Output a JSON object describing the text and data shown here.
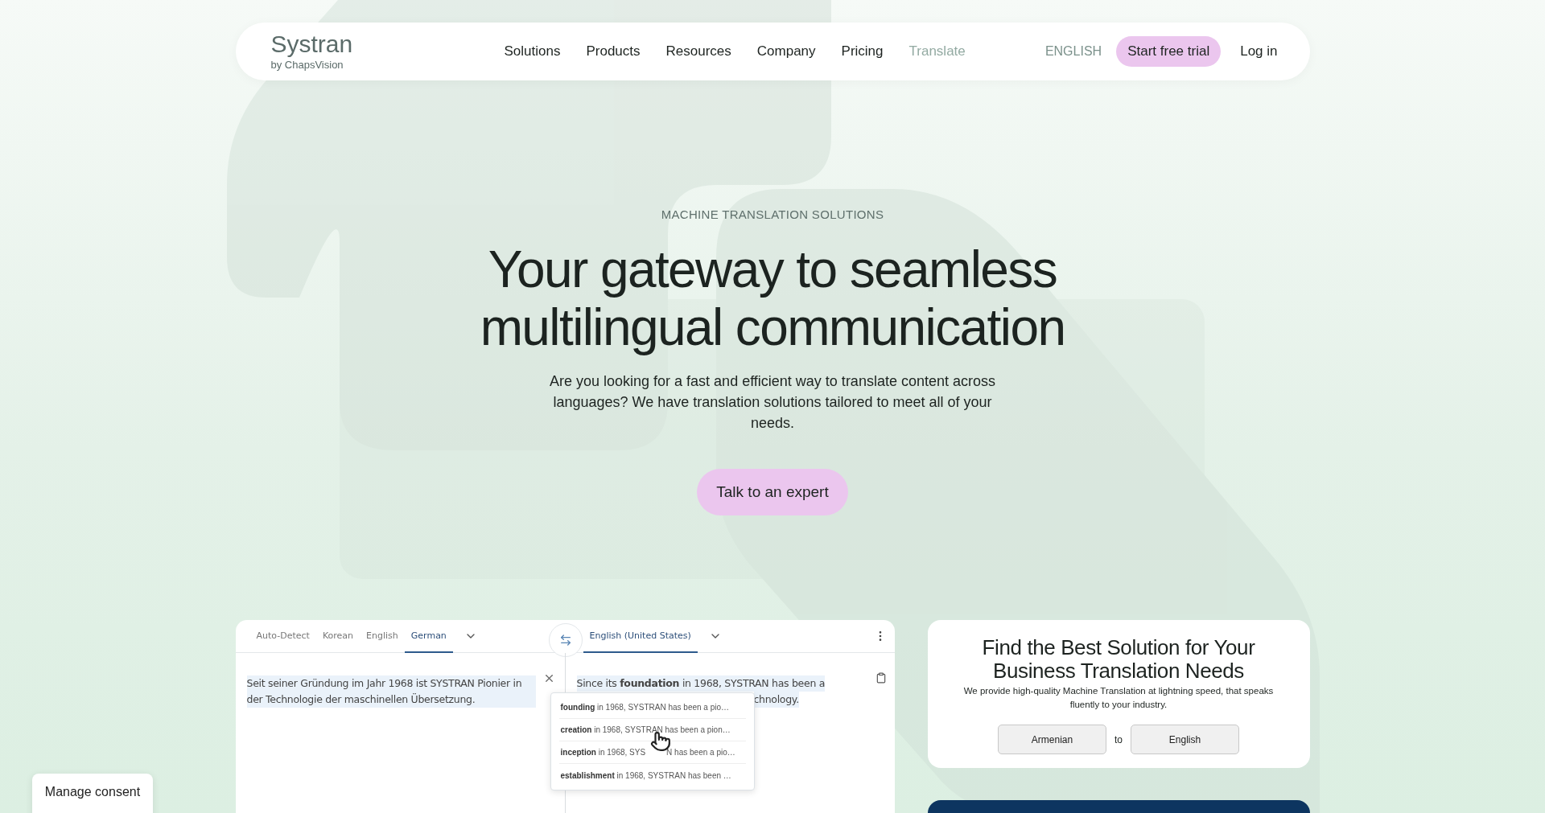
{
  "nav": {
    "logo": "Systran",
    "logo_sub": "by ChapsVision",
    "links": [
      {
        "label": "Solutions",
        "selected": false
      },
      {
        "label": "Products",
        "selected": false
      },
      {
        "label": "Resources",
        "selected": false
      },
      {
        "label": "Company",
        "selected": false
      },
      {
        "label": "Pricing",
        "selected": false
      },
      {
        "label": "Translate",
        "selected": true
      }
    ],
    "language": {
      "label": "ENGLISH",
      "selected": true
    },
    "cta": "Start free trial",
    "login": "Log in"
  },
  "hero": {
    "eyebrow": "MACHINE TRANSLATION SOLUTIONS",
    "title_lines": [
      "Your gateway to seamless",
      "multilingual communication"
    ],
    "paragraph": "Are you looking for a fast and efficient way to translate content across languages? We have translation solutions tailored to meet all of your needs.",
    "button": "Talk to an expert"
  },
  "translator": {
    "source_tabs": [
      {
        "label": "Auto-Detect",
        "selected": false
      },
      {
        "label": "Korean",
        "selected": false
      },
      {
        "label": "English",
        "selected": false
      },
      {
        "label": "German",
        "selected": true
      }
    ],
    "target_tabs": [
      {
        "label": "English (United States)",
        "selected": true
      }
    ],
    "source_text": "Seit seiner Gründung im Jahr 1968 ist SYSTRAN Pionier in der Technologie der maschinellen Übersetzung.",
    "target_text": "Since its **foundation** in 1968, SYSTRAN has been a",
    "target_text_tail": "chnology.",
    "suggestions": [
      {
        "text": "**founding** in 1968, SYSTRAN has been a pio…"
      },
      {
        "text": "**creation** in 1968, SYSTRAN has been a pion…"
      },
      {
        "text": "**inception** in 1968, SYS",
        "tail": "N has been a pio…"
      },
      {
        "text": "**establishment** in 1968, SYSTRAN has been …"
      }
    ]
  },
  "solution_card": {
    "title": "Find the Best Solution for Your Business Translation Needs",
    "text": "We provide high-quality Machine Translation at lightning speed, that speaks fluently to your industry.",
    "from": "Armenian",
    "connector": "to",
    "to": "English"
  },
  "consent": "Manage consent"
}
